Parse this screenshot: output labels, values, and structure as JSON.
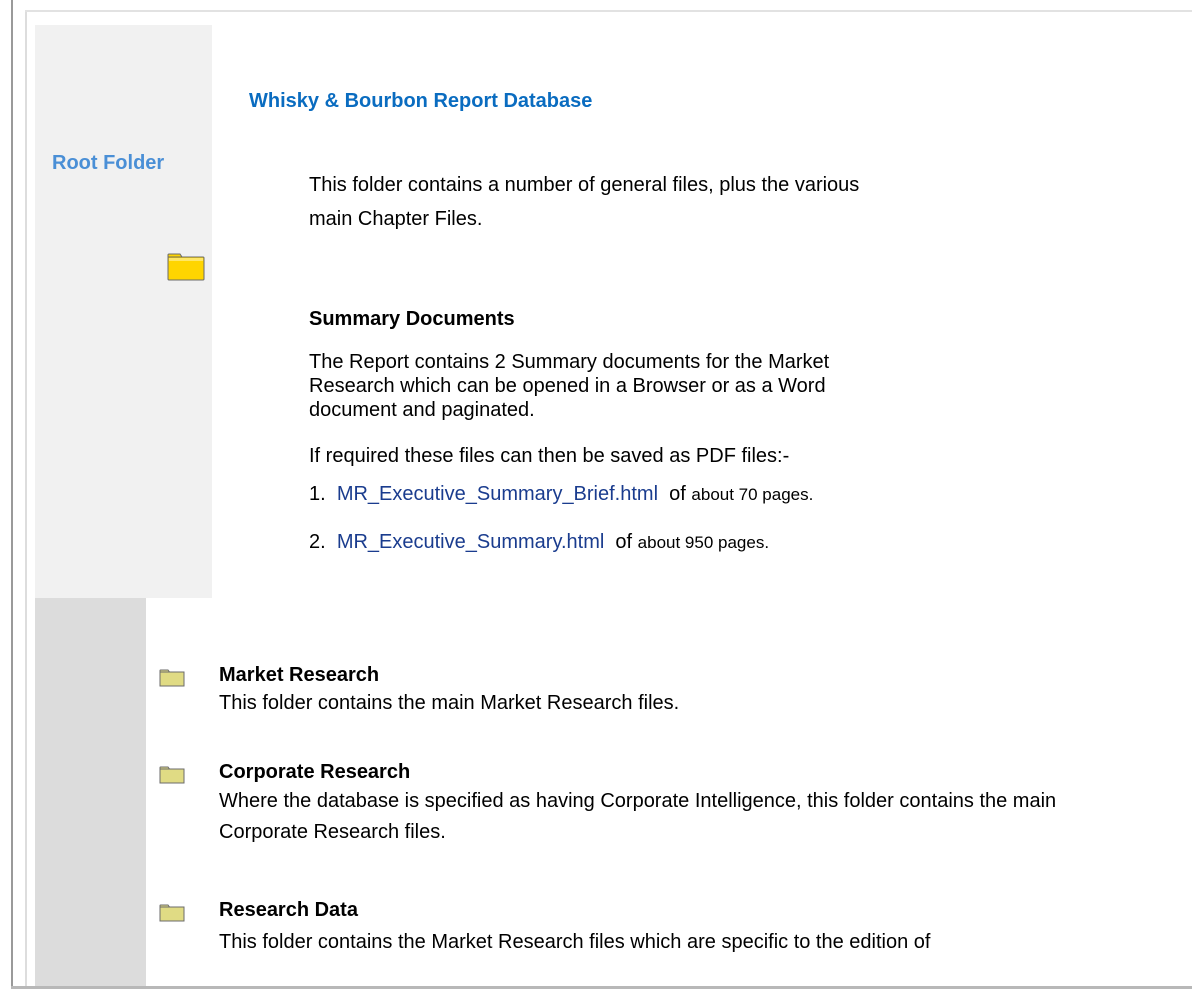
{
  "sidebar": {
    "label": "Root Folder"
  },
  "header": {
    "title": "Whisky & Bourbon Report Database"
  },
  "intro": {
    "text": "This folder contains a number of general files, plus the various main Chapter Files."
  },
  "summary": {
    "heading": "Summary Documents",
    "text": "The Report contains 2 Summary documents for the Market Research which can be opened in a Browser or as a Word document and paginated.",
    "save_note": "If required these files can then be saved as PDF files:-",
    "documents": [
      {
        "number": "1.",
        "file": "MR_Executive_Summary_Brief.html",
        "of": "of",
        "pages": "about 70 pages."
      },
      {
        "number": "2.",
        "file": "MR_Executive_Summary.html",
        "of": "of",
        "pages": "about 950 pages."
      }
    ]
  },
  "folders": [
    {
      "title": "Market Research",
      "description": "This folder contains the main Market Research files."
    },
    {
      "title": "Corporate Research",
      "description": "Where the database is specified as having Corporate Intelligence, this folder contains the main Corporate Research files."
    },
    {
      "title": "Research Data",
      "description": "This folder contains the Market Research files which are specific to the edition of"
    }
  ],
  "colors": {
    "title_blue": "#0a6cc0",
    "root_label_blue": "#4a8fd6",
    "link_blue": "#1a3c8e",
    "folder_yellow": "#ffd500",
    "small_folder": "#e0db84"
  },
  "icons": {
    "large_folder": "folder-icon",
    "small_folder": "folder-icon"
  }
}
